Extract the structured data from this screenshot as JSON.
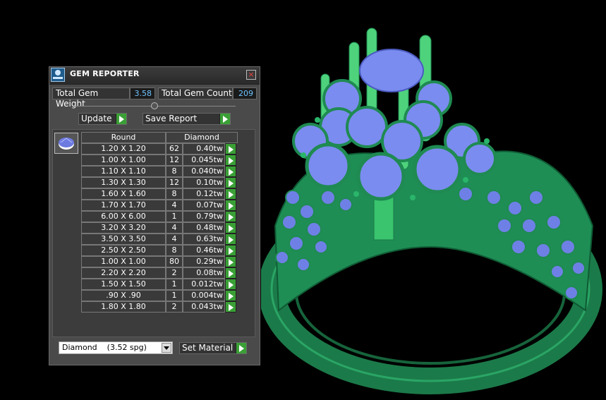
{
  "panel": {
    "title": "GEM REPORTER",
    "close_glyph": "×",
    "total_gem_weight_label": "Total Gem Weight",
    "total_gem_weight_value": "3.58",
    "total_gem_count_label": "Total Gem Count",
    "total_gem_count_value": "209",
    "update_label": "Update",
    "save_report_label": "Save Report",
    "table": {
      "header_shape": "Round",
      "header_material": "Diamond",
      "rows": [
        {
          "size": "1.20 X 1.20",
          "count": "62",
          "tw": "0.40tw"
        },
        {
          "size": "1.00 X 1.00",
          "count": "12",
          "tw": "0.045tw"
        },
        {
          "size": "1.10 X 1.10",
          "count": "8",
          "tw": "0.040tw"
        },
        {
          "size": "1.30 X 1.30",
          "count": "12",
          "tw": "0.10tw"
        },
        {
          "size": "1.60 X 1.60",
          "count": "8",
          "tw": "0.12tw"
        },
        {
          "size": "1.70 X 1.70",
          "count": "4",
          "tw": "0.07tw"
        },
        {
          "size": "6.00 X 6.00",
          "count": "1",
          "tw": "0.79tw"
        },
        {
          "size": "3.20 X 3.20",
          "count": "4",
          "tw": "0.48tw"
        },
        {
          "size": "3.50 X 3.50",
          "count": "4",
          "tw": "0.63tw"
        },
        {
          "size": "2.50 X 2.50",
          "count": "8",
          "tw": "0.46tw"
        },
        {
          "size": "1.00 X 1.00",
          "count": "80",
          "tw": "0.29tw"
        },
        {
          "size": "2.20 X 2.20",
          "count": "2",
          "tw": "0.08tw"
        },
        {
          "size": "1.50 X 1.50",
          "count": "1",
          "tw": "0.012tw"
        },
        {
          "size": ".90 X .90",
          "count": "1",
          "tw": "0.004tw"
        },
        {
          "size": "1.80 X 1.80",
          "count": "2",
          "tw": "0.043tw"
        }
      ]
    },
    "material_select_value": "Diamond    (3.52 spg)",
    "set_material_label": "Set Material"
  },
  "icons": [
    "gem-reporter-app-icon",
    "close-icon",
    "play-arrow-icon",
    "round-gem-icon",
    "dropdown-arrow-icon"
  ],
  "colors": {
    "ring_metal": "#1f8a52",
    "gems": "#7b8cf0",
    "accent_green": "#3aa036",
    "value_blue": "#6fc3ff"
  }
}
